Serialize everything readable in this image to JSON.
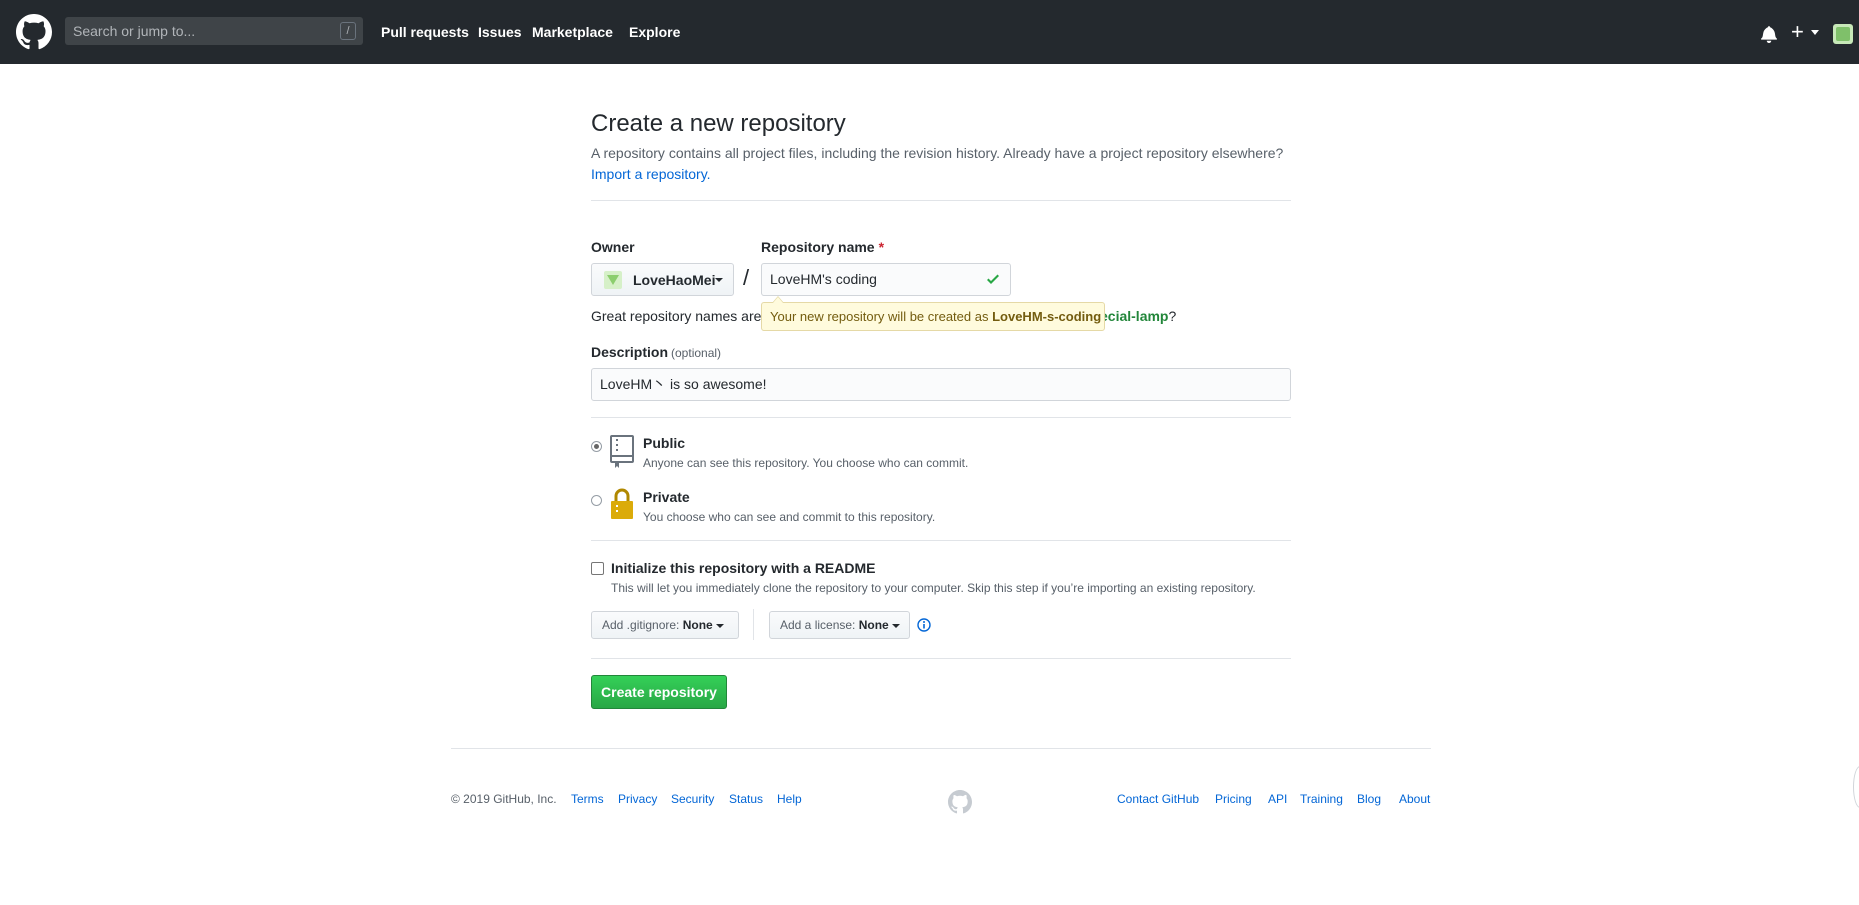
{
  "header": {
    "search_placeholder": "Search or jump to...",
    "slash_key": "/",
    "nav": [
      "Pull requests",
      "Issues",
      "Marketplace",
      "Explore"
    ],
    "icons": [
      "github-logo",
      "bell-icon",
      "plus-icon",
      "avatar"
    ]
  },
  "page": {
    "title": "Create a new repository",
    "subtitle": "A repository contains all project files, including the revision history. Already have a project repository elsewhere?",
    "import_link": "Import a repository."
  },
  "form": {
    "owner_label": "Owner",
    "owner_value": "LoveHaoMei",
    "separator": "/",
    "repo_name_label": "Repository name",
    "required_mark": "*",
    "repo_name_value": "LoveHM's coding",
    "great_names": "Great repository names are",
    "tooltip_text": "Your new repository will be created as",
    "tooltip_name": "LoveHM-s-coding",
    "suggest_name": "ecial-lamp",
    "suggest_tail": "?",
    "description_label": "Description",
    "description_optional": "(optional)",
    "description_value": "LoveHM丶 is so awesome!",
    "visibility": {
      "selected": "Public",
      "public_title": "Public",
      "public_note": "Anyone can see this repository. You choose who can commit.",
      "private_title": "Private",
      "private_note": "You choose who can see and commit to this repository."
    },
    "readme_title": "Initialize this repository with a README",
    "readme_note": "This will let you immediately clone the repository to your computer. Skip this step if you’re importing an existing repository.",
    "gitignore_label": "Add .gitignore:",
    "gitignore_value": "None",
    "license_label": "Add a license:",
    "license_value": "None",
    "create_button": "Create repository"
  },
  "footer": {
    "copyright": "© 2019 GitHub, Inc.",
    "left_links": [
      "Terms",
      "Privacy",
      "Security",
      "Status",
      "Help"
    ],
    "right_links": [
      "Contact GitHub",
      "Pricing",
      "API",
      "Training",
      "Blog",
      "About"
    ]
  },
  "colors": {
    "header_bg": "#24292e",
    "link": "#0366d6",
    "success": "#28a745",
    "tooltip_bg": "#fffbdd"
  }
}
